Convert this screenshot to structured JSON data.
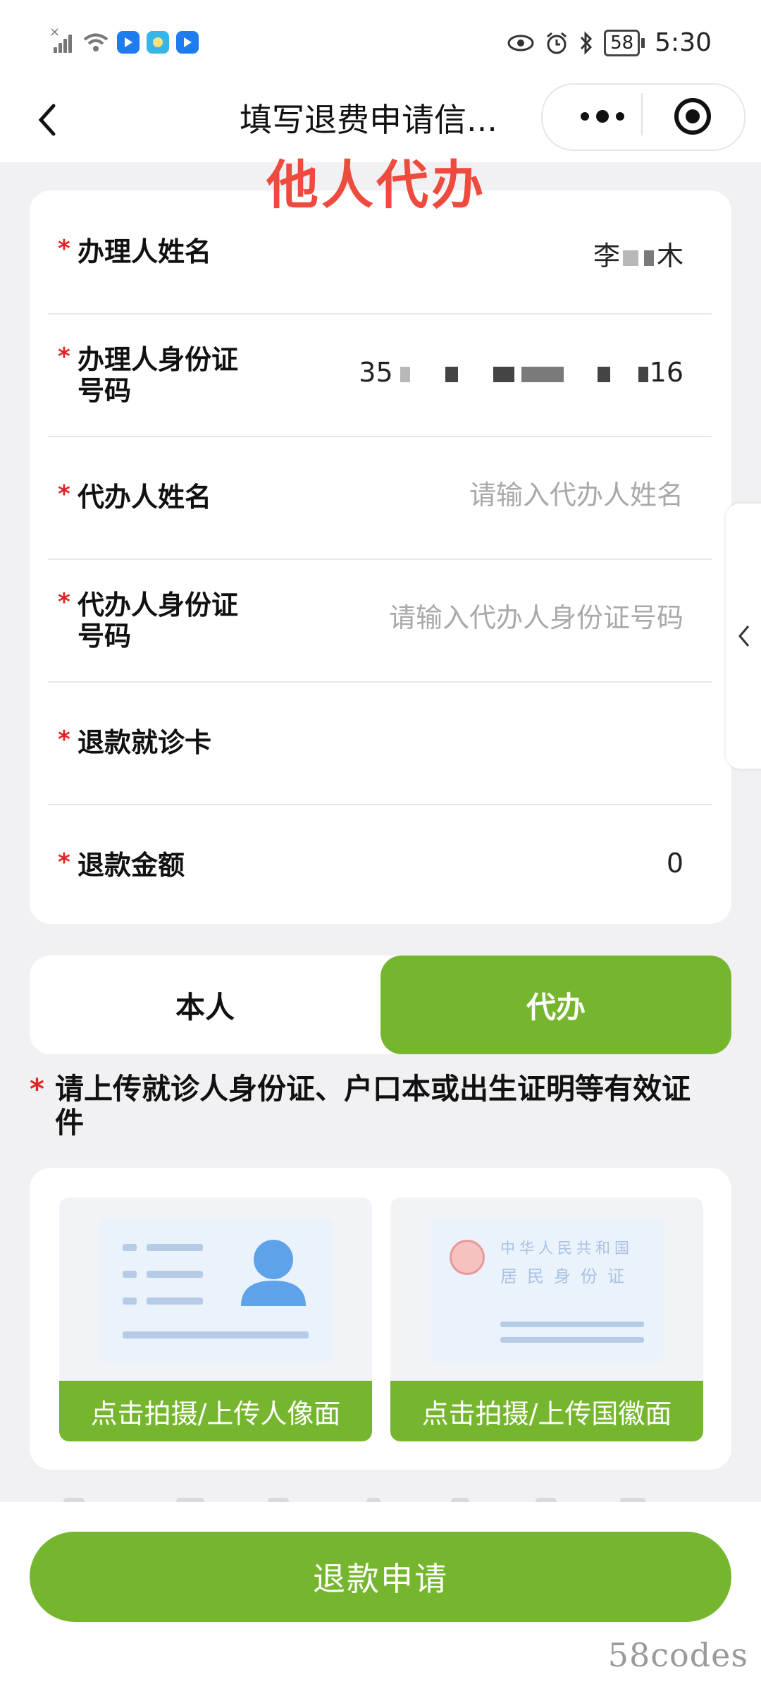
{
  "status_bar": {
    "time": "5:30",
    "battery": "58"
  },
  "nav": {
    "title": "填写退费申请信..."
  },
  "overlay_note": "他人代办",
  "form": {
    "rows": [
      {
        "label": "办理人姓名",
        "value_prefix": "李",
        "value_suffix": "木"
      },
      {
        "label_line1": "办理人身份证",
        "label_line2": "号码",
        "value_prefix": "35",
        "value_suffix": "16"
      },
      {
        "label": "代办人姓名",
        "placeholder": "请输入代办人姓名"
      },
      {
        "label_line1": "代办人身份证",
        "label_line2": "号码",
        "placeholder": "请输入代办人身份证号码"
      },
      {
        "label": "退款就诊卡"
      },
      {
        "label": "退款金额",
        "value": "0"
      }
    ]
  },
  "toggle": {
    "self_label": "本人",
    "agent_label": "代办",
    "selected": "代办"
  },
  "upload": {
    "instruction": "请上传就诊人身份证、户口本或出生证明等有效证件",
    "front_button": "点击拍摄/上传人像面",
    "back_button": "点击拍摄/上传国徽面",
    "id_card_title_1": "中华人民共和国",
    "id_card_title_2": "居民身份证"
  },
  "submit_label": "退款申请",
  "watermark": "58codes",
  "colors": {
    "accent_green": "#76b62f",
    "required_red": "#e02424",
    "overlay_red": "#ee4b3e",
    "avatar_blue": "#5ea3ea"
  }
}
